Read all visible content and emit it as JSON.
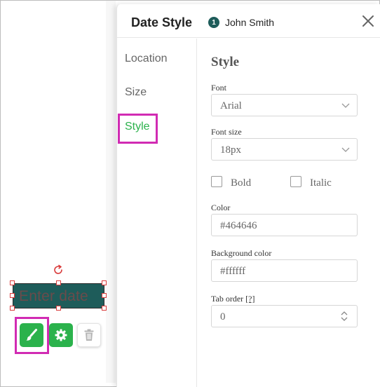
{
  "panel": {
    "title": "Date Style",
    "signer_number": "1",
    "signer_name": "John Smith"
  },
  "nav": {
    "items": [
      {
        "label": "Location",
        "active": false
      },
      {
        "label": "Size",
        "active": false
      },
      {
        "label": "Style",
        "active": true
      }
    ]
  },
  "style_section": {
    "title": "Style",
    "font": {
      "label": "Font",
      "value": "Arial"
    },
    "font_size": {
      "label": "Font size",
      "value": "18px"
    },
    "bold": {
      "label": "Bold",
      "checked": false
    },
    "italic": {
      "label": "Italic",
      "checked": false
    },
    "color": {
      "label": "Color",
      "value": "#464646"
    },
    "background_color": {
      "label": "Background color",
      "value": "#ffffff"
    },
    "tab_order": {
      "label": "Tab order",
      "help": "[?]",
      "value": "0"
    }
  },
  "canvas": {
    "date_field_placeholder": "Enter date"
  },
  "colors": {
    "accent_green": "#2bb24c",
    "highlight_magenta": "#d12bb3",
    "field_teal": "#1e5c5a",
    "handle_red": "#d93b3b"
  },
  "icons": {
    "rotate": "rotate-icon",
    "brush": "paintbrush-icon",
    "settings": "gear-icon",
    "delete": "trash-icon",
    "close": "close-icon"
  }
}
